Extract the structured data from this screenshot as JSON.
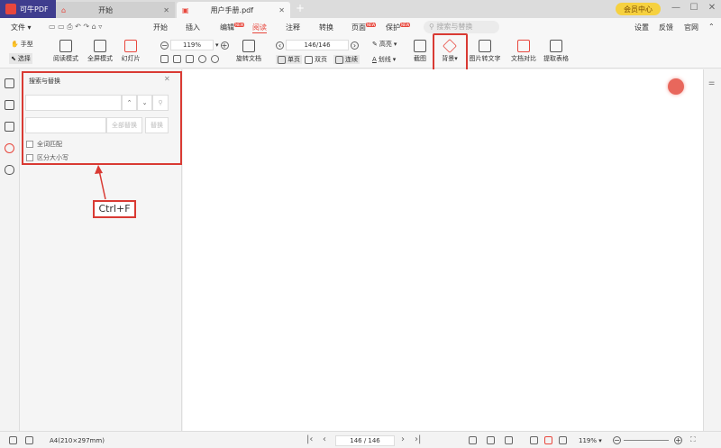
{
  "app": {
    "name": "可牛PDF",
    "vip": "会员中心"
  },
  "tabs": [
    {
      "label": "开始"
    },
    {
      "label": "用户手册.pdf"
    }
  ],
  "menu": {
    "file": "文件",
    "items": [
      "开始",
      "插入",
      "编辑",
      "阅读",
      "注释",
      "转换",
      "页面",
      "保护"
    ],
    "active": "阅读",
    "new_badge": "NEW",
    "search_placeholder": "搜索与替换",
    "right": [
      "设置",
      "反馈",
      "官网"
    ]
  },
  "toolbar": {
    "hand": "手型",
    "select": "选择",
    "read_mode": "阅读模式",
    "fullscreen": "全屏模式",
    "slideshow": "幻灯片",
    "zoom": "119%",
    "rotate": "旋转文档",
    "page": "146/146",
    "single": "单页",
    "double": "双页",
    "continuous": "连续",
    "highlight": "高亮",
    "underline": "划线",
    "screenshot": "截图",
    "background": "背景",
    "ocr": "图片转文字",
    "compare": "文档对比",
    "extract_table": "提取表格"
  },
  "panel": {
    "title": "搜索与替换",
    "replace_all": "全部替换",
    "replace": "替换",
    "whole_word": "全词匹配",
    "match_case": "区分大小写",
    "search_value": "",
    "replace_value": ""
  },
  "annotation": "Ctrl+F",
  "status": {
    "page_size": "A4(210×297mm)",
    "page": "146 / 146",
    "zoom": "119%"
  },
  "colors": {
    "accent": "#e8473d",
    "highlight_box": "#d93a33",
    "logo_bg": "#3f3d8e"
  }
}
